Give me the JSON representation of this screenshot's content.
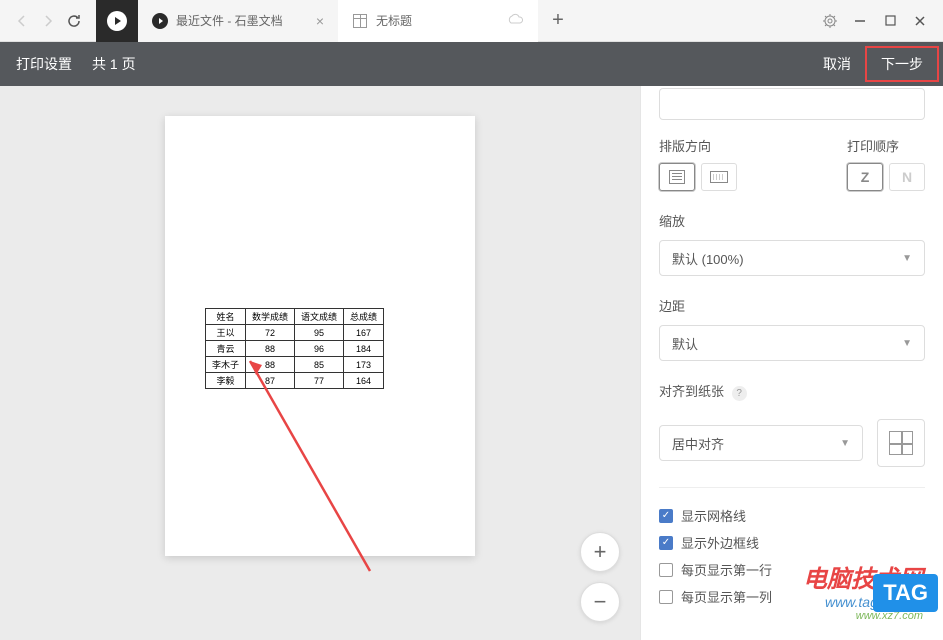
{
  "browser": {
    "tabs": [
      {
        "title": "最近文件 - 石墨文档"
      },
      {
        "title": "无标题"
      }
    ]
  },
  "header": {
    "title": "打印设置",
    "page_info": "共 1 页",
    "cancel": "取消",
    "next": "下一步"
  },
  "settings": {
    "layout_label": "排版方向",
    "order_label": "打印顺序",
    "zoom_label": "缩放",
    "zoom_value": "默认 (100%)",
    "margin_label": "边距",
    "margin_value": "默认",
    "align_label": "对齐到纸张",
    "align_value": "居中对齐",
    "checkboxes": {
      "show_grid": "显示网格线",
      "show_border": "显示外边框线",
      "each_page_1": "每页显示第一行",
      "each_page_2": "每页显示第一列"
    }
  },
  "watermark": {
    "text": "电脑技术网",
    "url1": "www.tagxp.com",
    "url2": "www.xz7.com",
    "tag": "TAG"
  },
  "chart_data": {
    "type": "table",
    "headers": [
      "姓名",
      "数学成绩",
      "语文成绩",
      "总成绩"
    ],
    "rows": [
      [
        "王以",
        "72",
        "95",
        "167"
      ],
      [
        "青云",
        "88",
        "96",
        "184"
      ],
      [
        "李木子",
        "88",
        "85",
        "173"
      ],
      [
        "李毅",
        "87",
        "77",
        "164"
      ]
    ]
  }
}
